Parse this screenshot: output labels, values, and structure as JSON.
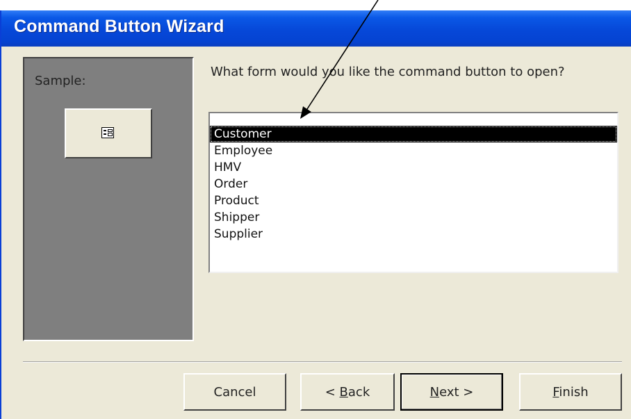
{
  "window": {
    "title": "Command Button Wizard"
  },
  "sample": {
    "label": "Sample:",
    "icon": "form-icon"
  },
  "prompt": {
    "question": "What form would you like the command button to open?"
  },
  "forms": {
    "selected_index": 0,
    "items": [
      {
        "label": "Customer"
      },
      {
        "label": "Employee"
      },
      {
        "label": "HMV"
      },
      {
        "label": "Order"
      },
      {
        "label": "Product"
      },
      {
        "label": "Shipper"
      },
      {
        "label": "Supplier"
      }
    ]
  },
  "buttons": {
    "cancel": "Cancel",
    "back_prefix": "< ",
    "back_accel": "B",
    "back_rest": "ack",
    "next_accel": "N",
    "next_rest": "ext >",
    "finish_accel": "F",
    "finish_rest": "inish"
  },
  "annotation": {
    "icon": "arrow-annotation",
    "color": "#000000"
  }
}
